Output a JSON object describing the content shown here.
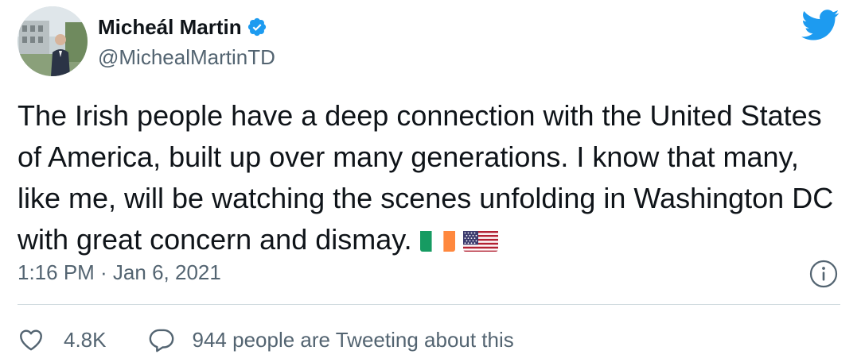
{
  "author": {
    "display_name": "Micheál Martin",
    "handle": "@MichealMartinTD",
    "verified": true
  },
  "tweet": {
    "text": "The Irish people have a deep connection with the United States of America, built up over many generations. I know that many, like me, will be watching the scenes unfolding in Washington DC with great concern and dismay.",
    "emojis": [
      "flag-ireland",
      "flag-usa"
    ],
    "timestamp": "1:16 PM · Jan 6, 2021"
  },
  "engagement": {
    "likes": "4.8K",
    "conversation_text": "944 people are Tweeting about this"
  },
  "icons": {
    "verified": "verified-badge-icon",
    "logo": "twitter-bird-icon",
    "info": "info-icon",
    "like": "heart-icon",
    "reply": "speech-bubble-icon"
  },
  "colors": {
    "twitter_blue": "#1d9bf0",
    "text_primary": "#0f1419",
    "text_secondary": "#536471",
    "divider": "#cfd9de"
  }
}
